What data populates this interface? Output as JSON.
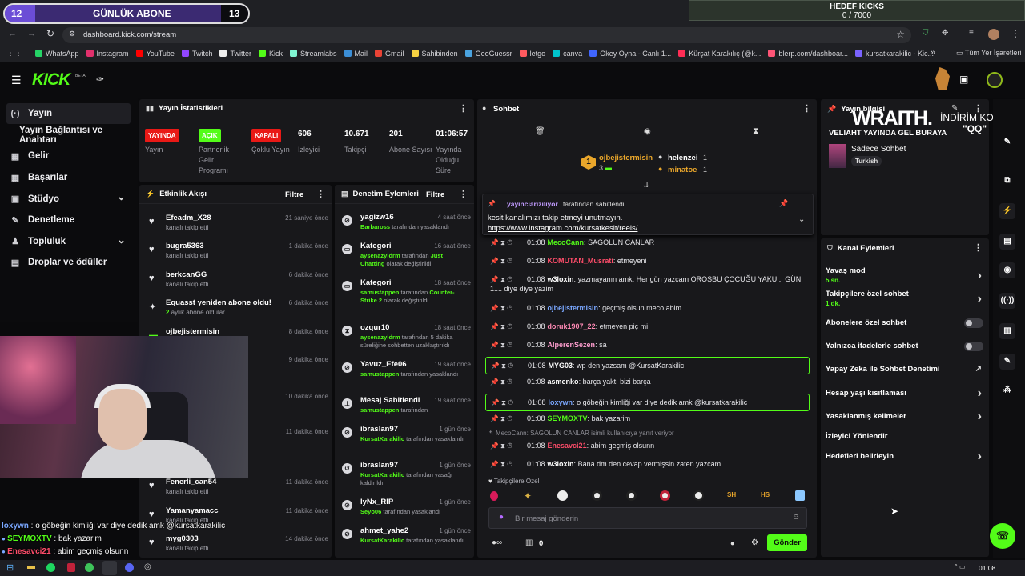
{
  "overlay": {
    "sub_left": "12",
    "sub_title": "GÜNLÜK ABONE",
    "sub_right": "13",
    "goal_title": "HEDEF KICKS",
    "goal_value": "0 / 7000",
    "promo_brand": "WRAITH.",
    "promo_code_label": "İNDİRİM KODU:",
    "promo_code": "\"QQ\"",
    "promo_tag": "VELIAHT YAYINDA GEL BURAYA"
  },
  "browser": {
    "url": "dashboard.kick.com/stream",
    "bookmarks": [
      "WhatsApp",
      "Instagram",
      "YouTube",
      "Twitch",
      "Twitter",
      "Kick",
      "Streamlabs",
      "Mail",
      "Gmail",
      "Sahibinden",
      "GeoGuessr",
      "letgo",
      "canva",
      "Okey Oyna - Canlı 1...",
      "Kürşat Karakılıç (@k...",
      "blerp.com/dashboar...",
      "kursatkarakilic - Kic..."
    ],
    "bookmarks_more": "»",
    "bookmarks_folder": "Tüm Yer İşaretleri"
  },
  "kick": {
    "logo": "KICK",
    "logo_beta": "BETA"
  },
  "nav": {
    "items": [
      {
        "label": "Yayın",
        "icon": "(·)"
      },
      {
        "label": "Yayın Bağlantısı ve Anahtarı",
        "icon": ""
      },
      {
        "label": "Gelir",
        "icon": "▦"
      },
      {
        "label": "Başarılar",
        "icon": "▦"
      },
      {
        "label": "Stüdyo",
        "icon": "▣"
      },
      {
        "label": "Denetleme",
        "icon": "✎"
      },
      {
        "label": "Topluluk",
        "icon": "♟"
      },
      {
        "label": "Droplar ve ödüller",
        "icon": "▤"
      }
    ]
  },
  "stats": {
    "title": "Yayın İstatistikleri",
    "items": [
      {
        "value": "YAYINDA",
        "label": "Yayın",
        "badge": "#e91916"
      },
      {
        "value": "AÇIK",
        "label": "Partnerlik Gelir Programı",
        "badge": "#53fc18"
      },
      {
        "value": "KAPALI",
        "label": "Çoklu Yayın",
        "badge": "#e91916"
      },
      {
        "value": "606",
        "label": "İzleyici"
      },
      {
        "value": "10.671",
        "label": "Takipçi"
      },
      {
        "value": "201",
        "label": "Abone Sayısı"
      },
      {
        "value": "01:06:57",
        "label": "Yayında Olduğu Süre"
      }
    ]
  },
  "activity": {
    "title": "Etkinlik Akışı",
    "filter": "Filtre",
    "items": [
      {
        "name": "Efeadm_X28",
        "sub": "kanalı takip etti",
        "time": "21 saniye önce",
        "icon": "♥"
      },
      {
        "name": "bugra5363",
        "sub": "kanalı takip etti",
        "time": "1 dakika önce",
        "icon": "♥"
      },
      {
        "name": "berkcanGG",
        "sub": "kanalı takip etti",
        "time": "6 dakika önce",
        "icon": "♥"
      },
      {
        "name": "Equasst yeniden abone oldu!",
        "sub_hl": "2",
        "sub": " aylık abone oldular",
        "time": "6 dakika önce",
        "icon": "✦"
      },
      {
        "name": "ojbejistermisin",
        "sub": "ya abonelik hediye etti.",
        "time": "8 dakika önce",
        "icon": "▬"
      },
      {
        "name": "",
        "sub": "eciya abonelik hediye",
        "time": "9 dakika önce",
        "icon": ""
      },
      {
        "name": "",
        "sub": "abonelik hediye etti.",
        "time": "10 dakika önce",
        "icon": ""
      },
      {
        "name": "",
        "sub": "a abonelik hediye etti.",
        "time": "11 dakika önce",
        "icon": ""
      },
      {
        "name": "Fenerli_can54",
        "sub": "kanalı takip etti",
        "time": "11 dakika önce",
        "icon": "♥"
      },
      {
        "name": "Yamanyamacc",
        "sub": "kanalı takip etti",
        "time": "11 dakika önce",
        "icon": "♥"
      },
      {
        "name": "myg0303",
        "sub": "kanalı takip etti",
        "time": "14 dakika önce",
        "icon": "♥"
      }
    ]
  },
  "mod": {
    "title": "Denetim Eylemleri",
    "filter": "Filtre",
    "items": [
      {
        "name": "yagizw16",
        "s1": "Barbaross",
        "s2": " tarafından yasaklandı",
        "time": "4 saat önce",
        "icon": "⊘"
      },
      {
        "name": "Kategori",
        "s1": "aysenazyldrm",
        "s2": " tarafından ",
        "s3": "Just Chatting",
        "s4": " olarak değiştirildi",
        "time": "16 saat önce",
        "icon": "▭"
      },
      {
        "name": "Kategori",
        "s1": "samustappen",
        "s2": " tarafından ",
        "s3": "Counter-Strike 2",
        "s4": " olarak değiştirildi",
        "time": "18 saat önce",
        "icon": "▭"
      },
      {
        "name": "ozqur10",
        "s1": "aysenazyldrm",
        "s2": " tarafından 5 dakika süreliğine sohbetten uzaklaştırıldı",
        "time": "18 saat önce",
        "icon": "⧗"
      },
      {
        "name": "Yavuz_Efe06",
        "s1": "samustappen",
        "s2": " tarafından yasaklandı",
        "time": "19 saat önce",
        "icon": "⊘"
      },
      {
        "name": "Mesaj Sabitlendi",
        "s1": "samustappen",
        "s2": " tarafından",
        "time": "19 saat önce",
        "icon": "⊥"
      },
      {
        "name": "ibraslan97",
        "s1": "KursatKarakilic",
        "s2": " tarafından yasaklandı",
        "time": "1 gün önce",
        "icon": "⊘"
      },
      {
        "name": "ibraslan97",
        "s1": "KursatKarakilic",
        "s2": " tarafından yasağı kaldırıldı",
        "time": "1 gün önce",
        "icon": "↺"
      },
      {
        "name": "lyNx_RIP",
        "s1": "Seyo06",
        "s2": " tarafından yasaklandı",
        "time": "1 gün önce",
        "icon": "⊘"
      },
      {
        "name": "ahmet_yahe2",
        "s1": "KursatKarakilic",
        "s2": " tarafından yasaklandı",
        "time": "1 gün önce",
        "icon": "⊘"
      }
    ]
  },
  "chat": {
    "title": "Sohbet",
    "top": [
      {
        "rank": "1",
        "name": "ojbejistermisin",
        "count": "3"
      },
      {
        "name": "helenzei",
        "count": "1"
      },
      {
        "name": "minatoe",
        "count": "1"
      }
    ],
    "pinned": {
      "by": "yayinciariziliyor",
      "by_suffix": " tarafından sabitlendi",
      "text": "kesit kanalımızı takip etmeyi unutmayın.",
      "link": "https://www.instagram.com/kursatkesit/reels/"
    },
    "messages": [
      {
        "time": "01:08",
        "user": "MecoCann",
        "color": "#53fc18",
        "text": "SAGOLUN CANLAR",
        "hl": false
      },
      {
        "time": "01:08",
        "user": "KOMUTAN_Musrati",
        "color": "#ff4d6a",
        "text": "etmeyeni",
        "hl": false
      },
      {
        "time": "01:08",
        "user": "w3loxin",
        "color": "#ffffff",
        "text": "yazmayanın amk. Her gün yazcam OROSBU ÇOCUĞU YAKU... GÜN 1.... diye diye yazim",
        "hl": false
      },
      {
        "time": "01:08",
        "user": "ojbejistermisin",
        "color": "#7aa7ff",
        "text": "geçmiş olsun meco abim",
        "hl": false
      },
      {
        "time": "01:08",
        "user": "doruk1907_22",
        "color": "#ff8ab5",
        "text": "etmeyen piç mi",
        "hl": false
      },
      {
        "time": "01:08",
        "user": "AlperenSezen",
        "color": "#ff9ecf",
        "text": "sa",
        "hl": false
      },
      {
        "time": "01:08",
        "user": "MYG03",
        "color": "#ffffff",
        "text": "wp den yazsam @KursatKarakilic",
        "hl": true
      },
      {
        "time": "01:08",
        "user": "asmenko",
        "color": "#ffffff",
        "text": "barça yaktı bizi barça",
        "hl": false
      },
      {
        "time": "01:08",
        "user": "loxywn",
        "color": "#7aa7ff",
        "text": "o göbeğin kimliği var diye dedik amk @kursatkarakilic",
        "hl": true
      },
      {
        "time": "01:08",
        "user": "SEYMOXTV",
        "color": "#53fc18",
        "text": "bak yazarim",
        "hl": false
      },
      {
        "time": "01:08",
        "user": "Enesavci21",
        "color": "#ff4d6a",
        "text": "abim geçmiş olsunn",
        "hl": false
      },
      {
        "time": "01:08",
        "user": "w3loxin",
        "color": "#ffffff",
        "text": "Bana dm den cevap vermişsin zaten yazcam",
        "hl": false
      }
    ],
    "reply_note": "MecoCann: SAGOLUN CANLAR isimli kullanıcıya yanıt veriyor",
    "followers_only": "Takipçilere Özel",
    "placeholder": "Bir mesaj gönderin",
    "points": "0",
    "send": "Gönder"
  },
  "info": {
    "title": "Yayın bilgisi",
    "name": "Sadece Sohbet",
    "tag": "Turkish"
  },
  "actions": {
    "title": "Kanal Eylemleri",
    "items": [
      {
        "label": "Yavaş mod",
        "sub": "5 sn.",
        "kind": "chev"
      },
      {
        "label": "Takipçilere özel sohbet",
        "sub": "1 dk.",
        "kind": "chev"
      },
      {
        "label": "Abonelere özel sohbet",
        "sub": "",
        "kind": "toggle"
      },
      {
        "label": "Yalnızca ifadelerle sohbet",
        "sub": "",
        "kind": "toggle"
      },
      {
        "label": "Yapay Zeka ile Sohbet Denetimi",
        "sub": "",
        "kind": "ext"
      },
      {
        "label": "Hesap yaşı kısıtlaması",
        "sub": "",
        "kind": "chev"
      },
      {
        "label": "Yasaklanmış kelimeler",
        "sub": "",
        "kind": "chev"
      },
      {
        "label": "İzleyici Yönlendir",
        "sub": "",
        "kind": "none"
      },
      {
        "label": "Hedefleri belirleyin",
        "sub": "",
        "kind": "chev"
      }
    ]
  },
  "overlay_chat": [
    {
      "user": "loxywn",
      "text": " : o göbeğin kimliği var diye dedik amk @kursatkarakilic",
      "color": "#7aa7ff"
    },
    {
      "user": "SEYMOXTV",
      "text": " : bak yazarim",
      "color": "#53fc18"
    },
    {
      "user": "Enesavci21",
      "text": " : abim geçmiş olsunn",
      "color": "#ff4d6a"
    }
  ],
  "taskbar": {
    "clock": "01:08"
  },
  "colors": {
    "kick_green": "#53fc18",
    "panel": "#18181b",
    "bg": "#0a0a0c",
    "live_red": "#e91916"
  }
}
